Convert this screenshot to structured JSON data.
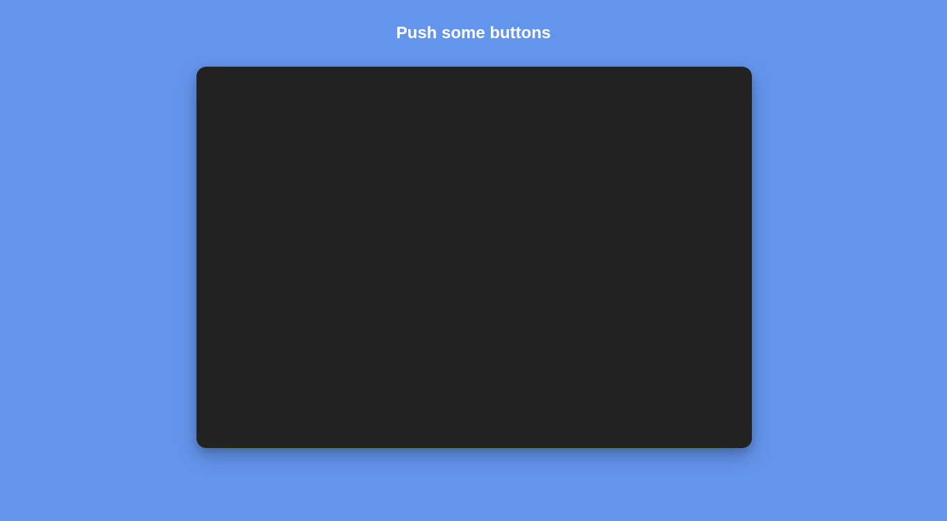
{
  "page": {
    "title": "Push some buttons",
    "background_color": "#6495ed",
    "title_color": "#ffffff"
  },
  "panel": {
    "background_color": "#222222"
  }
}
